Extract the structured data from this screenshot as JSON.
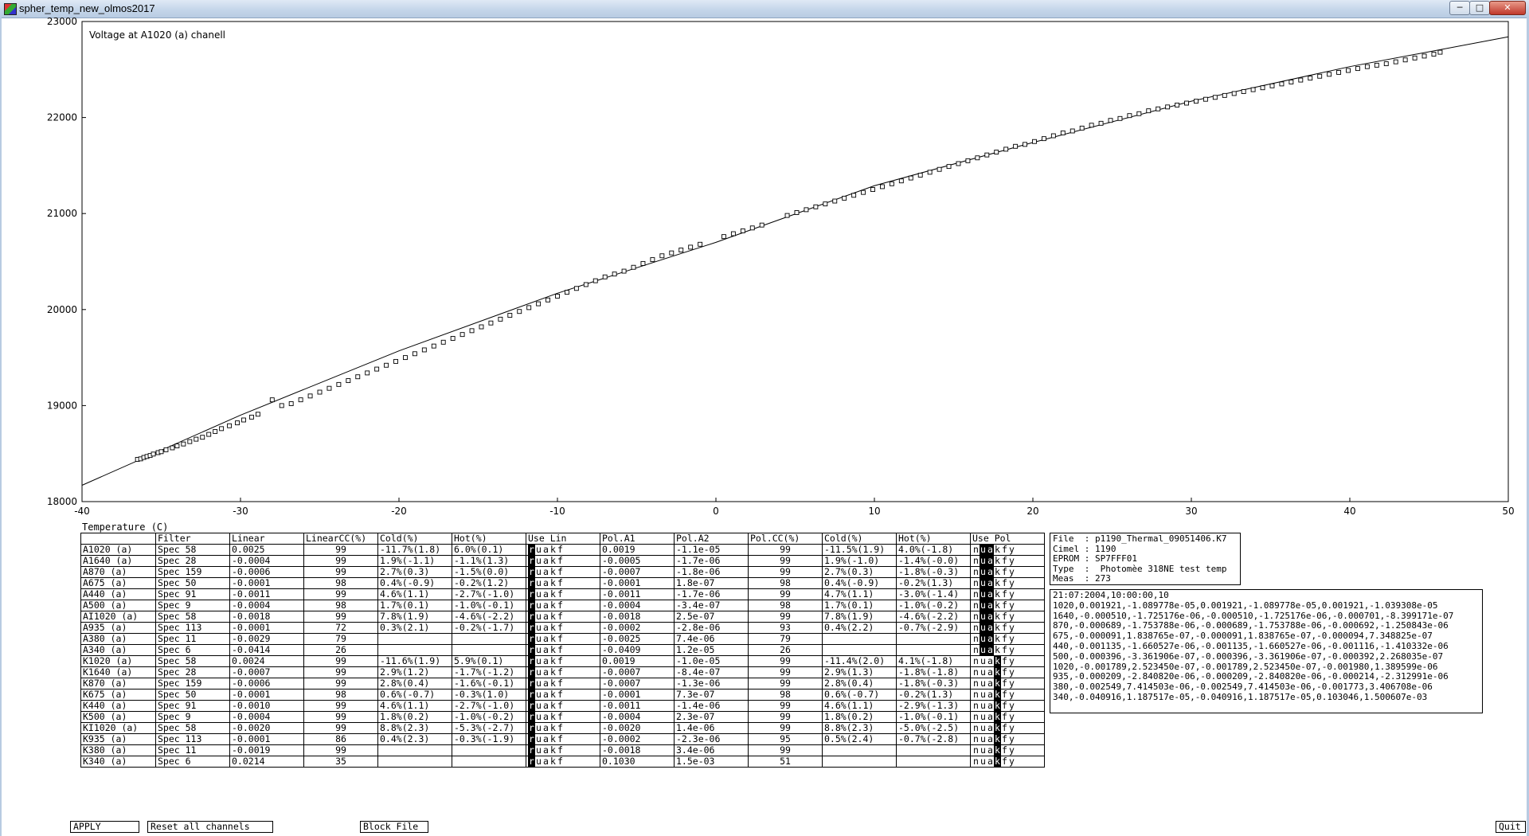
{
  "window": {
    "title": "spher_temp_new_olmos2017",
    "min_label": "─",
    "max_label": "□",
    "close_label": "✕"
  },
  "chart_data": {
    "type": "scatter",
    "title": "Voltage at A1020 (a) chanell",
    "xlabel": "Temperature (C)",
    "ylabel": "",
    "xlim": [
      -40,
      50
    ],
    "ylim": [
      18000,
      23000
    ],
    "x_ticks": [
      "-40",
      "-30",
      "-20",
      "-10",
      "0",
      "10",
      "20",
      "30",
      "40",
      "50"
    ],
    "y_ticks": [
      "18000",
      "19000",
      "20000",
      "21000",
      "22000",
      "23000"
    ],
    "fit_line": [
      [
        -40,
        18170
      ],
      [
        -30,
        18900
      ],
      [
        -20,
        19570
      ],
      [
        -10,
        20170
      ],
      [
        0,
        20700
      ],
      [
        10,
        21290
      ],
      [
        20,
        21740
      ],
      [
        30,
        22170
      ],
      [
        40,
        22530
      ],
      [
        50,
        22840
      ]
    ],
    "points": [
      [
        -36.5,
        18440
      ],
      [
        -36.3,
        18445
      ],
      [
        -36.1,
        18460
      ],
      [
        -35.9,
        18470
      ],
      [
        -35.7,
        18480
      ],
      [
        -35.5,
        18495
      ],
      [
        -35.2,
        18510
      ],
      [
        -35.0,
        18520
      ],
      [
        -34.7,
        18540
      ],
      [
        -34.3,
        18560
      ],
      [
        -34.0,
        18580
      ],
      [
        -33.6,
        18600
      ],
      [
        -33.2,
        18625
      ],
      [
        -32.8,
        18650
      ],
      [
        -32.4,
        18670
      ],
      [
        -32.0,
        18700
      ],
      [
        -31.6,
        18730
      ],
      [
        -31.2,
        18760
      ],
      [
        -30.7,
        18790
      ],
      [
        -30.2,
        18820
      ],
      [
        -29.8,
        18850
      ],
      [
        -29.3,
        18880
      ],
      [
        -28.9,
        18910
      ],
      [
        -28.0,
        19060
      ],
      [
        -27.4,
        19000
      ],
      [
        -26.8,
        19020
      ],
      [
        -26.2,
        19060
      ],
      [
        -25.6,
        19100
      ],
      [
        -25.0,
        19140
      ],
      [
        -24.4,
        19180
      ],
      [
        -23.8,
        19220
      ],
      [
        -23.2,
        19260
      ],
      [
        -22.6,
        19300
      ],
      [
        -22.0,
        19340
      ],
      [
        -21.4,
        19380
      ],
      [
        -20.8,
        19420
      ],
      [
        -20.2,
        19460
      ],
      [
        -19.6,
        19500
      ],
      [
        -19.0,
        19540
      ],
      [
        -18.4,
        19580
      ],
      [
        -17.8,
        19620
      ],
      [
        -17.2,
        19660
      ],
      [
        -16.6,
        19700
      ],
      [
        -16.0,
        19740
      ],
      [
        -15.4,
        19780
      ],
      [
        -14.8,
        19820
      ],
      [
        -14.2,
        19860
      ],
      [
        -13.6,
        19900
      ],
      [
        -13.0,
        19940
      ],
      [
        -12.4,
        19980
      ],
      [
        -11.8,
        20020
      ],
      [
        -11.2,
        20060
      ],
      [
        -10.6,
        20100
      ],
      [
        -10.0,
        20140
      ],
      [
        -9.4,
        20180
      ],
      [
        -8.8,
        20220
      ],
      [
        -8.2,
        20260
      ],
      [
        -7.6,
        20300
      ],
      [
        -7.0,
        20340
      ],
      [
        -6.4,
        20370
      ],
      [
        -5.8,
        20400
      ],
      [
        -5.2,
        20440
      ],
      [
        -4.6,
        20480
      ],
      [
        -4.0,
        20520
      ],
      [
        -3.4,
        20560
      ],
      [
        -2.8,
        20590
      ],
      [
        -2.2,
        20620
      ],
      [
        -1.6,
        20650
      ],
      [
        -1.0,
        20680
      ],
      [
        0.5,
        20760
      ],
      [
        1.1,
        20790
      ],
      [
        1.7,
        20820
      ],
      [
        2.3,
        20850
      ],
      [
        2.9,
        20880
      ],
      [
        4.5,
        20980
      ],
      [
        5.1,
        21010
      ],
      [
        5.7,
        21040
      ],
      [
        6.3,
        21070
      ],
      [
        6.9,
        21100
      ],
      [
        7.5,
        21130
      ],
      [
        8.1,
        21160
      ],
      [
        8.7,
        21190
      ],
      [
        9.3,
        21220
      ],
      [
        9.9,
        21250
      ],
      [
        10.5,
        21280
      ],
      [
        11.1,
        21310
      ],
      [
        11.7,
        21340
      ],
      [
        12.3,
        21370
      ],
      [
        12.9,
        21400
      ],
      [
        13.5,
        21430
      ],
      [
        14.1,
        21460
      ],
      [
        14.7,
        21490
      ],
      [
        15.3,
        21520
      ],
      [
        15.9,
        21550
      ],
      [
        16.5,
        21580
      ],
      [
        17.1,
        21610
      ],
      [
        17.7,
        21640
      ],
      [
        18.3,
        21670
      ],
      [
        18.9,
        21700
      ],
      [
        19.5,
        21720
      ],
      [
        20.1,
        21750
      ],
      [
        20.7,
        21780
      ],
      [
        21.3,
        21810
      ],
      [
        21.9,
        21840
      ],
      [
        22.5,
        21860
      ],
      [
        23.1,
        21890
      ],
      [
        23.7,
        21920
      ],
      [
        24.3,
        21940
      ],
      [
        24.9,
        21970
      ],
      [
        25.5,
        21990
      ],
      [
        26.1,
        22020
      ],
      [
        26.7,
        22040
      ],
      [
        27.3,
        22070
      ],
      [
        27.9,
        22090
      ],
      [
        28.5,
        22110
      ],
      [
        29.1,
        22130
      ],
      [
        29.7,
        22150
      ],
      [
        30.3,
        22170
      ],
      [
        30.9,
        22190
      ],
      [
        31.5,
        22210
      ],
      [
        32.1,
        22230
      ],
      [
        32.7,
        22250
      ],
      [
        33.3,
        22270
      ],
      [
        33.9,
        22290
      ],
      [
        34.5,
        22310
      ],
      [
        35.1,
        22330
      ],
      [
        35.7,
        22350
      ],
      [
        36.3,
        22370
      ],
      [
        36.9,
        22390
      ],
      [
        37.5,
        22410
      ],
      [
        38.1,
        22430
      ],
      [
        38.7,
        22450
      ],
      [
        39.3,
        22470
      ],
      [
        39.9,
        22490
      ],
      [
        40.5,
        22510
      ],
      [
        41.1,
        22530
      ],
      [
        41.7,
        22545
      ],
      [
        42.3,
        22560
      ],
      [
        42.9,
        22580
      ],
      [
        43.5,
        22600
      ],
      [
        44.1,
        22620
      ],
      [
        44.7,
        22640
      ],
      [
        45.3,
        22660
      ],
      [
        45.7,
        22680
      ]
    ]
  },
  "table": {
    "temp_label": "Temperature (C)",
    "headers": [
      "",
      "Filter",
      "Linear",
      "LinearCC(%)",
      "Cold(%)",
      "Hot(%)",
      "Use Lin",
      "Pol.A1",
      "Pol.A2",
      "Pol.CC(%)",
      "Cold(%)",
      "Hot(%)",
      "Use Pol"
    ],
    "rows": [
      {
        "ch": "A1020 (a)",
        "filter": "Spec 58",
        "linear": "0.0025",
        "lincc": "99",
        "cold": "-11.7%(1.8)",
        "hot": "6.0%(0.1)",
        "uselin": "r",
        "pa1": "0.0019",
        "pa2": "-1.1e-05",
        "pcc": "99",
        "pcold": "-11.5%(1.9)",
        "phot": "4.0%(-1.8)",
        "usepol": "ua"
      },
      {
        "ch": "A1640 (a)",
        "filter": "Spec 28",
        "linear": "-0.0004",
        "lincc": "99",
        "cold": "1.9%(-1.1)",
        "hot": "-1.1%(1.3)",
        "uselin": "r",
        "pa1": "-0.0005",
        "pa2": "-1.7e-06",
        "pcc": "99",
        "pcold": "1.9%(-1.0)",
        "phot": "-1.4%(-0.0)",
        "usepol": "ua"
      },
      {
        "ch": "A870 (a)",
        "filter": "Spec 159",
        "linear": "-0.0006",
        "lincc": "99",
        "cold": "2.7%(0.3)",
        "hot": "-1.5%(0.0)",
        "uselin": "r",
        "pa1": "-0.0007",
        "pa2": "-1.8e-06",
        "pcc": "99",
        "pcold": "2.7%(0.3)",
        "phot": "-1.8%(-0.3)",
        "usepol": "ua"
      },
      {
        "ch": "A675 (a)",
        "filter": "Spec 50",
        "linear": "-0.0001",
        "lincc": "98",
        "cold": "0.4%(-0.9)",
        "hot": "-0.2%(1.2)",
        "uselin": "r",
        "pa1": "-0.0001",
        "pa2": "1.8e-07",
        "pcc": "98",
        "pcold": "0.4%(-0.9)",
        "phot": "-0.2%(1.3)",
        "usepol": "ua"
      },
      {
        "ch": "A440 (a)",
        "filter": "Spec 91",
        "linear": "-0.0011",
        "lincc": "99",
        "cold": "4.6%(1.1)",
        "hot": "-2.7%(-1.0)",
        "uselin": "r",
        "pa1": "-0.0011",
        "pa2": "-1.7e-06",
        "pcc": "99",
        "pcold": "4.7%(1.1)",
        "phot": "-3.0%(-1.4)",
        "usepol": "ua"
      },
      {
        "ch": "A500 (a)",
        "filter": "Spec 9",
        "linear": "-0.0004",
        "lincc": "98",
        "cold": "1.7%(0.1)",
        "hot": "-1.0%(-0.1)",
        "uselin": "r",
        "pa1": "-0.0004",
        "pa2": "-3.4e-07",
        "pcc": "98",
        "pcold": "1.7%(0.1)",
        "phot": "-1.0%(-0.2)",
        "usepol": "ua"
      },
      {
        "ch": "AI1020 (a)",
        "filter": "Spec 58",
        "linear": "-0.0018",
        "lincc": "99",
        "cold": "7.8%(1.9)",
        "hot": "-4.6%(-2.2)",
        "uselin": "r",
        "pa1": "-0.0018",
        "pa2": "2.5e-07",
        "pcc": "99",
        "pcold": "7.8%(1.9)",
        "phot": "-4.6%(-2.2)",
        "usepol": "ua"
      },
      {
        "ch": "A935 (a)",
        "filter": "Spec 113",
        "linear": "-0.0001",
        "lincc": "72",
        "cold": "0.3%(2.1)",
        "hot": "-0.2%(-1.7)",
        "uselin": "r",
        "pa1": "-0.0002",
        "pa2": "-2.8e-06",
        "pcc": "93",
        "pcold": "0.4%(2.2)",
        "phot": "-0.7%(-2.9)",
        "usepol": "ua"
      },
      {
        "ch": "A380 (a)",
        "filter": "Spec 11",
        "linear": "-0.0029",
        "lincc": "79",
        "cold": "",
        "hot": "",
        "uselin": "r",
        "pa1": "-0.0025",
        "pa2": "7.4e-06",
        "pcc": "79",
        "pcold": "",
        "phot": "",
        "usepol": "ua"
      },
      {
        "ch": "A340 (a)",
        "filter": "Spec 6",
        "linear": "-0.0414",
        "lincc": "26",
        "cold": "",
        "hot": "",
        "uselin": "r",
        "pa1": "-0.0409",
        "pa2": "1.2e-05",
        "pcc": "26",
        "pcold": "",
        "phot": "",
        "usepol": "ua"
      },
      {
        "ch": "K1020 (a)",
        "filter": "Spec 58",
        "linear": "0.0024",
        "lincc": "99",
        "cold": "-11.6%(1.9)",
        "hot": "5.9%(0.1)",
        "uselin": "r",
        "pa1": "0.0019",
        "pa2": "-1.0e-05",
        "pcc": "99",
        "pcold": "-11.4%(2.0)",
        "phot": "4.1%(-1.8)",
        "usepol": "k"
      },
      {
        "ch": "K1640 (a)",
        "filter": "Spec 28",
        "linear": "-0.0007",
        "lincc": "99",
        "cold": "2.9%(1.2)",
        "hot": "-1.7%(-1.2)",
        "uselin": "r",
        "pa1": "-0.0007",
        "pa2": "-8.4e-07",
        "pcc": "99",
        "pcold": "2.9%(1.3)",
        "phot": "-1.8%(-1.8)",
        "usepol": "k"
      },
      {
        "ch": "K870 (a)",
        "filter": "Spec 159",
        "linear": "-0.0006",
        "lincc": "99",
        "cold": "2.8%(0.4)",
        "hot": "-1.6%(-0.1)",
        "uselin": "r",
        "pa1": "-0.0007",
        "pa2": "-1.3e-06",
        "pcc": "99",
        "pcold": "2.8%(0.4)",
        "phot": "-1.8%(-0.3)",
        "usepol": "k"
      },
      {
        "ch": "K675 (a)",
        "filter": "Spec 50",
        "linear": "-0.0001",
        "lincc": "98",
        "cold": "0.6%(-0.7)",
        "hot": "-0.3%(1.0)",
        "uselin": "r",
        "pa1": "-0.0001",
        "pa2": "7.3e-07",
        "pcc": "98",
        "pcold": "0.6%(-0.7)",
        "phot": "-0.2%(1.3)",
        "usepol": "k"
      },
      {
        "ch": "K440 (a)",
        "filter": "Spec 91",
        "linear": "-0.0010",
        "lincc": "99",
        "cold": "4.6%(1.1)",
        "hot": "-2.7%(-1.0)",
        "uselin": "r",
        "pa1": "-0.0011",
        "pa2": "-1.4e-06",
        "pcc": "99",
        "pcold": "4.6%(1.1)",
        "phot": "-2.9%(-1.3)",
        "usepol": "k"
      },
      {
        "ch": "K500 (a)",
        "filter": "Spec 9",
        "linear": "-0.0004",
        "lincc": "99",
        "cold": "1.8%(0.2)",
        "hot": "-1.0%(-0.2)",
        "uselin": "r",
        "pa1": "-0.0004",
        "pa2": "2.3e-07",
        "pcc": "99",
        "pcold": "1.8%(0.2)",
        "phot": "-1.0%(-0.1)",
        "usepol": "k"
      },
      {
        "ch": "KI1020 (a)",
        "filter": "Spec 58",
        "linear": "-0.0020",
        "lincc": "99",
        "cold": "8.8%(2.3)",
        "hot": "-5.3%(-2.7)",
        "uselin": "r",
        "pa1": "-0.0020",
        "pa2": "1.4e-06",
        "pcc": "99",
        "pcold": "8.8%(2.3)",
        "phot": "-5.0%(-2.5)",
        "usepol": "k"
      },
      {
        "ch": "K935 (a)",
        "filter": "Spec 113",
        "linear": "-0.0001",
        "lincc": "86",
        "cold": "0.4%(2.3)",
        "hot": "-0.3%(-1.9)",
        "uselin": "r",
        "pa1": "-0.0002",
        "pa2": "-2.3e-06",
        "pcc": "95",
        "pcold": "0.5%(2.4)",
        "phot": "-0.7%(-2.8)",
        "usepol": "k"
      },
      {
        "ch": "K380 (a)",
        "filter": "Spec 11",
        "linear": "-0.0019",
        "lincc": "99",
        "cold": "",
        "hot": "",
        "uselin": "r",
        "pa1": "-0.0018",
        "pa2": "3.4e-06",
        "pcc": "99",
        "pcold": "",
        "phot": "",
        "usepol": "k"
      },
      {
        "ch": "K340 (a)",
        "filter": "Spec 6",
        "linear": "0.0214",
        "lincc": "35",
        "cold": "",
        "hot": "",
        "uselin": "r",
        "pa1": "0.1030",
        "pa2": "1.5e-03",
        "pcc": "51",
        "pcold": "",
        "phot": "",
        "usepol": "k"
      }
    ],
    "use_lin_letters": [
      "r",
      "u",
      "a",
      "k",
      "f"
    ],
    "use_pol_letters": [
      "n",
      "u",
      "a",
      "k",
      "f",
      "y"
    ]
  },
  "info": {
    "lines": [
      "File  : p1190_Thermal_09051406.K7",
      "Cimel : 1190",
      "EPROM : SP7FFF01",
      "Type  :  Photomèe 318NE test temp",
      "Meas  : 273"
    ]
  },
  "log": {
    "lines": [
      "21:07:2004,10:00:00,10",
      "1020,0.001921,-1.089778e-05,0.001921,-1.089778e-05,0.001921,-1.039308e-05",
      "1640,-0.000510,-1.725176e-06,-0.000510,-1.725176e-06,-0.000701,-8.399171e-07",
      "870,-0.000689,-1.753788e-06,-0.000689,-1.753788e-06,-0.000692,-1.250843e-06",
      "675,-0.000091,1.838765e-07,-0.000091,1.838765e-07,-0.000094,7.348825e-07",
      "440,-0.001135,-1.660527e-06,-0.001135,-1.660527e-06,-0.001116,-1.410332e-06",
      "500,-0.000396,-3.361906e-07,-0.000396,-3.361906e-07,-0.000392,2.268035e-07",
      "1020,-0.001789,2.523450e-07,-0.001789,2.523450e-07,-0.001980,1.389599e-06",
      "935,-0.000209,-2.840820e-06,-0.000209,-2.840820e-06,-0.000214,-2.312991e-06",
      "380,-0.002549,7.414503e-06,-0.002549,7.414503e-06,-0.001773,3.406708e-06",
      "340,-0.040916,1.187517e-05,-0.040916,1.187517e-05,0.103046,1.500607e-03"
    ]
  },
  "buttons": {
    "apply": "APPLY",
    "reset": "Reset all channels",
    "block": "Block File",
    "quit": "Quit"
  }
}
